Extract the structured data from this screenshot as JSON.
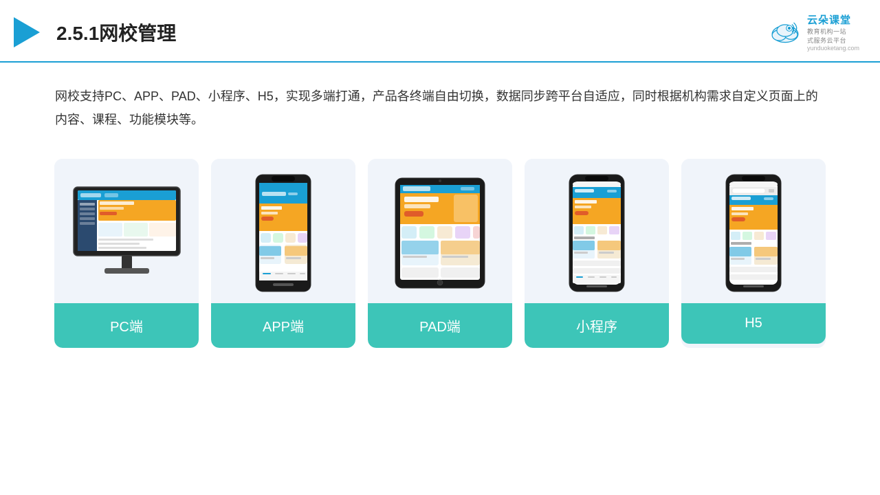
{
  "header": {
    "title": "2.5.1网校管理",
    "logo_main": "云朵课堂",
    "logo_domain": "yunduoketang.com",
    "logo_tagline": "教育机构一站",
    "logo_tagline2": "式服务云平台"
  },
  "description": "网校支持PC、APP、PAD、小程序、H5，实现多端打通，产品各终端自由切换，数据同步跨平台自适应，同时根据机构需求自定义页面上的内容、课程、功能模块等。",
  "cards": [
    {
      "id": "pc",
      "label": "PC端"
    },
    {
      "id": "app",
      "label": "APP端"
    },
    {
      "id": "pad",
      "label": "PAD端"
    },
    {
      "id": "miniprogram",
      "label": "小程序"
    },
    {
      "id": "h5",
      "label": "H5"
    }
  ]
}
